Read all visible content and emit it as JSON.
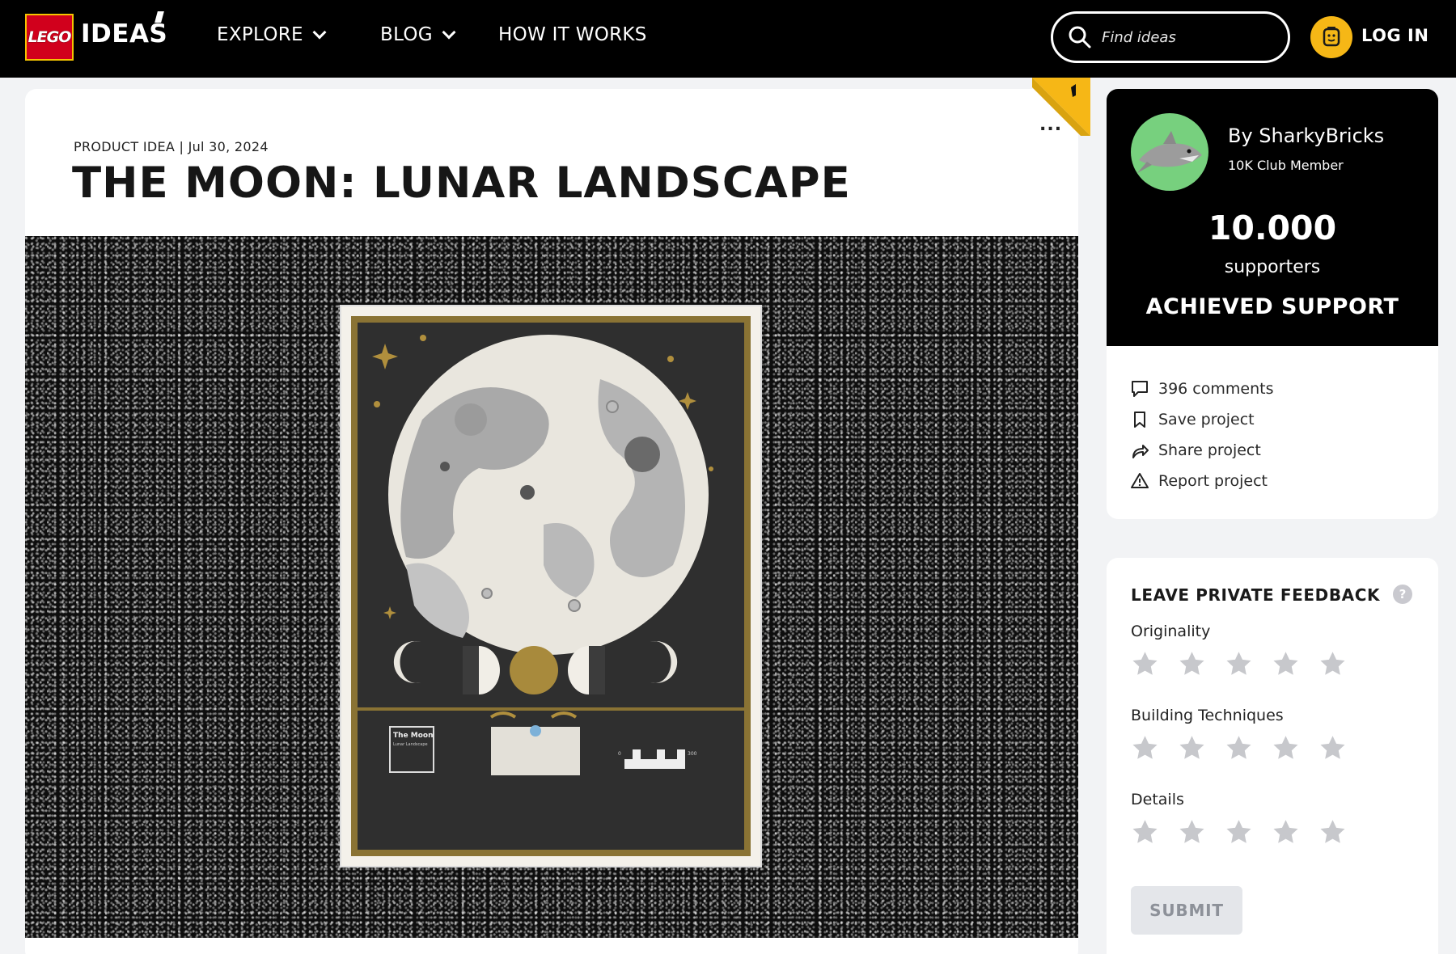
{
  "nav": {
    "logo_text": "LEGO",
    "brand_text": "IDEAS",
    "items": [
      {
        "label": "EXPLORE",
        "has_dropdown": true
      },
      {
        "label": "BLOG",
        "has_dropdown": true
      },
      {
        "label": "HOW IT WORKS",
        "has_dropdown": false
      }
    ],
    "search_placeholder": "Find ideas",
    "login_label": "LOG IN"
  },
  "project": {
    "category": "PRODUCT IDEA",
    "date": "Jul 30, 2024",
    "title": "THE MOON: LUNAR LANDSCAPE",
    "more_label": "...",
    "poster_label": "The Moon",
    "poster_sublabel": "Lunar Landscape",
    "poster_scale_start": "0",
    "poster_scale_end": "300"
  },
  "author": {
    "name": "By SharkyBricks",
    "rank": "10K Club Member",
    "supporters_count": "10.000",
    "supporters_label": "supporters",
    "status": "ACHIEVED SUPPORT",
    "actions": [
      {
        "label": "396 comments",
        "icon": "comment-icon"
      },
      {
        "label": "Save project",
        "icon": "bookmark-icon"
      },
      {
        "label": "Share project",
        "icon": "share-icon"
      },
      {
        "label": "Report project",
        "icon": "warning-icon"
      }
    ]
  },
  "feedback": {
    "title": "LEAVE PRIVATE FEEDBACK",
    "help_label": "?",
    "criteria": [
      {
        "label": "Originality",
        "rating": 0,
        "max": 5
      },
      {
        "label": "Building Techniques",
        "rating": 0,
        "max": 5
      },
      {
        "label": "Details",
        "rating": 0,
        "max": 5
      }
    ],
    "submit_label": "SUBMIT"
  },
  "colors": {
    "nav_bg": "#000000",
    "lego_red": "#d1001c",
    "accent_yellow": "#f6b716",
    "avatar_green": "#77d07e",
    "star_gray": "#c7c8cc",
    "submit_bg": "#e4e6ea"
  }
}
